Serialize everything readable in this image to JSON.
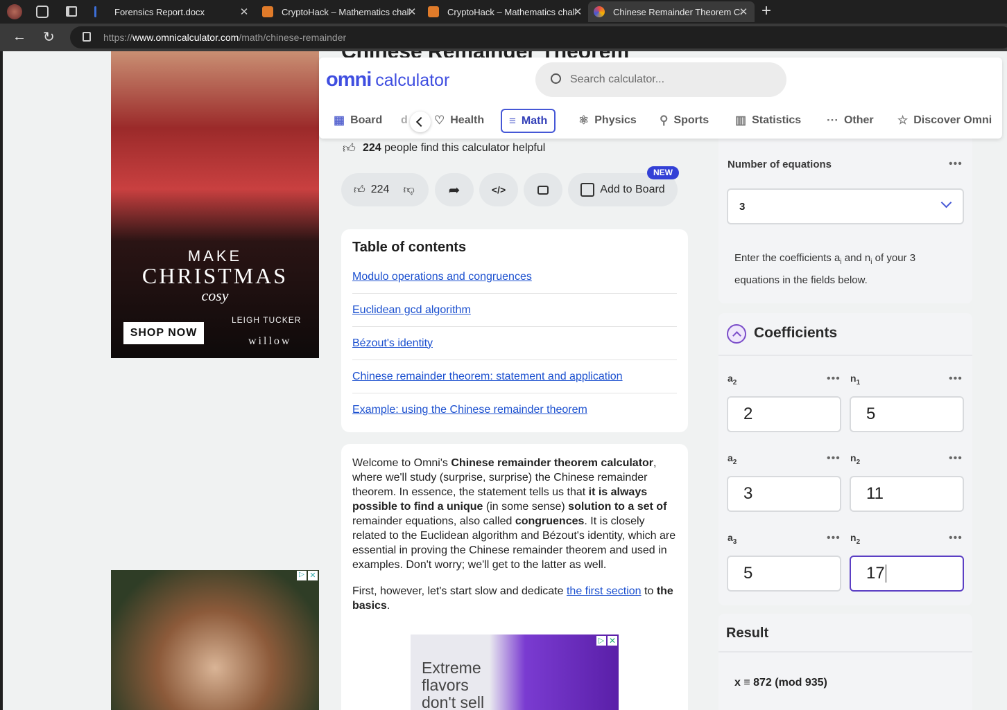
{
  "browser": {
    "tabs": [
      {
        "label": "Forensics Report.docx",
        "favicon_color": "#3d6fd8"
      },
      {
        "label": "CryptoHack – Mathematics challe",
        "favicon_color": "#e07b2a"
      },
      {
        "label": "CryptoHack – Mathematics challe",
        "favicon_color": "#e07b2a"
      },
      {
        "label": "Chinese Remainder Theorem Calc",
        "favicon_color": "#4557d6"
      }
    ],
    "url_prefix": "https://",
    "url_host": "www.omnicalculator.com",
    "url_path": "/math/chinese-remainder"
  },
  "header": {
    "logo_omni": "omni",
    "logo_calculator": "calculator",
    "search_placeholder": "Search calculator...",
    "nav": [
      "Board",
      "Health",
      "Math",
      "Physics",
      "Sports",
      "Statistics",
      "Other",
      "Discover Omni"
    ],
    "nav_partial": "d"
  },
  "article": {
    "title_partial": "Chinese Remainder Theorem",
    "helpful_count": "224",
    "helpful_text": "people find this calculator helpful",
    "like_count": "224",
    "add_to_board": "Add to Board",
    "new_badge": "NEW",
    "toc_title": "Table of contents",
    "toc": [
      "Modulo operations and congruences",
      "Euclidean gcd algorithm",
      "Bézout's identity",
      "Chinese remainder theorem: statement and application",
      "Example: using the Chinese remainder theorem"
    ],
    "intro": {
      "p1_a": "Welcome to Omni's ",
      "p1_b": "Chinese remainder theorem calculator",
      "p1_c": ", where we'll study (surprise, surprise) the Chinese remainder theorem. In essence, the statement tells us that ",
      "p1_d": "it is always possible to find a unique",
      "p1_e": " (in some sense) ",
      "p1_f": "solution to a set of",
      "p1_g": " remainder equations, also called ",
      "p1_h": "congruences",
      "p1_i": ". It is closely related to the Euclidean algorithm and Bézout's identity, which are essential in proving the Chinese remainder theorem and used in examples. Don't worry; we'll get to the latter as well.",
      "p2_a": "First, however, let's start slow and dedicate ",
      "p2_link": "the first section",
      "p2_b": " to ",
      "p2_c": "the basics",
      "p2_d": "."
    },
    "ad_text": "Extreme flavors don't sell"
  },
  "ads": {
    "christmas_make": "MAKE",
    "christmas_big": "CHRISTMAS",
    "christmas_cosy": "cosy",
    "shop_now": "SHOP NOW",
    "brand1": "LEIGH TUCKER",
    "brand2": "willow"
  },
  "calculator": {
    "num_eq_label": "Number of equations",
    "num_eq_value": "3",
    "hint_a": "Enter the coefficients a",
    "hint_sub": "i",
    "hint_b": " and n",
    "hint_c": " of your 3 equations in the fields below.",
    "coeff_title": "Coefficients",
    "fields": [
      {
        "a_label": "a",
        "a_sub": "2",
        "a_value": "2",
        "n_label": "n",
        "n_sub": "1",
        "n_value": "5"
      },
      {
        "a_label": "a",
        "a_sub": "2",
        "a_value": "3",
        "n_label": "n",
        "n_sub": "2",
        "n_value": "11"
      },
      {
        "a_label": "a",
        "a_sub": "3",
        "a_value": "5",
        "n_label": "n",
        "n_sub": "2",
        "n_value": "17"
      }
    ],
    "result_title": "Result",
    "result_value": "x ≡ 872 (mod 935)"
  }
}
